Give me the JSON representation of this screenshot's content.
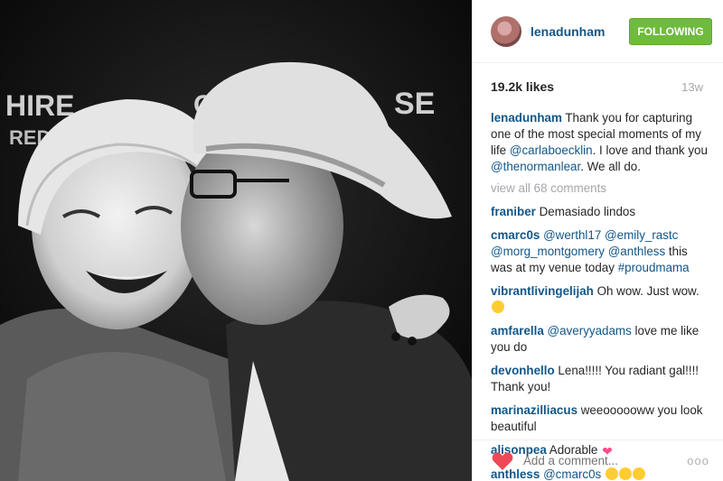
{
  "post": {
    "username": "lenadunham",
    "follow_label": "FOLLOWING",
    "likes": "19.2k likes",
    "time": "13w",
    "caption": {
      "username": "lenadunham",
      "text_1": "Thank you for capturing one of the most special moments of my life",
      "mention_1": "@carlaboecklin",
      "text_2": ". I love and thank you",
      "mention_2": "@thenormanlear",
      "text_3": ". We all do."
    },
    "view_all": "view all 68 comments",
    "add_comment_placeholder": "Add a comment...",
    "more_label": "ooo"
  },
  "photo": {
    "backdrop_text_left": "HIRE",
    "backdrop_text_left2": "RED",
    "backdrop_text_right": "SE",
    "backdrop_text_c": "C"
  },
  "comments": [
    {
      "user": "franiber",
      "text": "Demasiado lindos"
    },
    {
      "user": "cmarc0s",
      "mention_1": "@werthl17",
      "mention_2": "@emily_rastc",
      "mention_3": "@morg_montgomery",
      "mention_4": "@anthless",
      "text": "this was at my venue today",
      "hashtag": "#proudmama"
    },
    {
      "user": "vibrantlivingelijah",
      "text": "Oh wow. Just wow."
    },
    {
      "user": "amfarella",
      "mention_1": "@averyyadams",
      "text": "love me like you do"
    },
    {
      "user": "devonhello",
      "text": "Lena!!!!! You radiant gal!!!! Thank you!"
    },
    {
      "user": "marinazilliacus",
      "text": "weeoooooww you look beautiful"
    },
    {
      "user": "alisonpea",
      "text": "Adorable"
    },
    {
      "user": "anthless",
      "mention_1": "@cmarc0s"
    }
  ],
  "colors": {
    "link": "#125688",
    "follow_green": "#6fbb3e",
    "heart_red": "#ed4956",
    "muted": "#a5a7aa"
  },
  "icons": {
    "like": "heart-icon",
    "more": "more-options-icon"
  }
}
